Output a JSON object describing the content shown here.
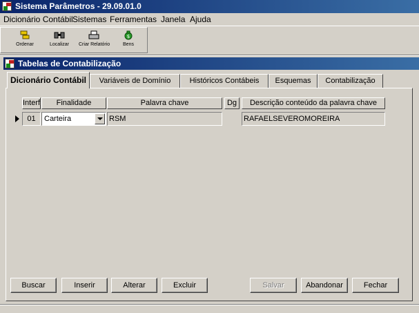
{
  "window": {
    "title": "Sistema Parâmetros - 29.09.01.0"
  },
  "menu": [
    "Dicionário Contábil",
    "Sistemas",
    "Ferramentas",
    "Janela",
    "Ajuda"
  ],
  "toolbar": {
    "ordenar": "Ordenar",
    "localizar": "Localizar",
    "criar_relatorio": "Criar Relatório",
    "bens": "Bens"
  },
  "child_window": {
    "title": "Tabelas de Contabilização"
  },
  "tabs": [
    "Dicionário Contábil",
    "Variáveis de Domínio",
    "Históricos Contábeis",
    "Esquemas",
    "Contabilização"
  ],
  "grid": {
    "headers": {
      "interface": "Interf",
      "finalidade": "Finalidade",
      "palavra": "Palavra chave",
      "dg": "Dg",
      "descricao": "Descrição conteúdo da palavra chave"
    },
    "rows": [
      {
        "interface": "01",
        "finalidade": "Carteira",
        "palavra": "RSM",
        "dg": "",
        "descricao": "RAFAELSEVEROMOREIRA"
      }
    ]
  },
  "buttons": {
    "buscar": "Buscar",
    "inserir": "Inserir",
    "alterar": "Alterar",
    "excluir": "Excluir",
    "salvar": "Salvar",
    "abandonar": "Abandonar",
    "fechar": "Fechar"
  }
}
